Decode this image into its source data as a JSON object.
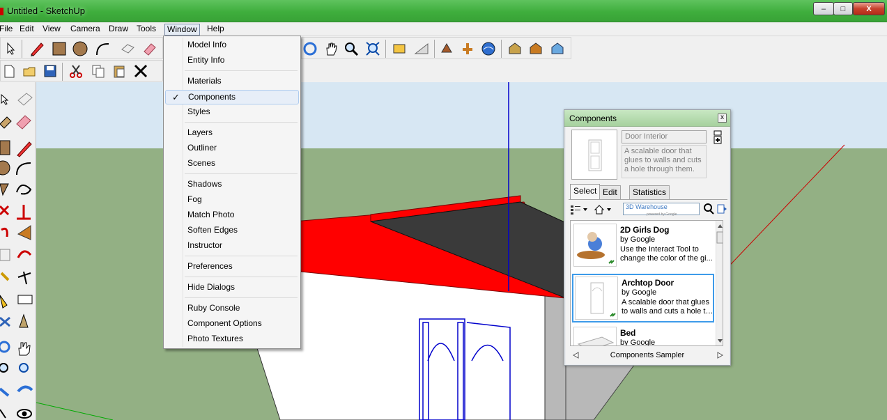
{
  "window": {
    "title": "Untitled - SketchUp",
    "minimize": "–",
    "maximize": "□",
    "close": "X"
  },
  "menubar": {
    "items": [
      "File",
      "Edit",
      "View",
      "Camera",
      "Draw",
      "Tools",
      "Window",
      "Help"
    ]
  },
  "dropdown": {
    "groups": [
      [
        "Model Info",
        "Entity Info"
      ],
      [
        "Materials",
        "Components",
        "Styles"
      ],
      [
        "Layers",
        "Outliner",
        "Scenes"
      ],
      [
        "Shadows",
        "Fog",
        "Match Photo",
        "Soften Edges",
        "Instructor"
      ],
      [
        "Preferences"
      ],
      [
        "Hide Dialogs"
      ],
      [
        "Ruby Console",
        "Component Options",
        "Photo Textures"
      ]
    ],
    "checked_item": "Components",
    "check_glyph": "✓"
  },
  "components": {
    "title": "Components",
    "close_glyph": "x",
    "name": "Door Interior",
    "description": "A scalable door that glues to walls and cuts a hole through them.",
    "tabs": [
      "Select",
      "Edit",
      "Statistics"
    ],
    "active_tab": "Select",
    "search_placeholder": "3D Warehouse",
    "search_brand": "powered by Google",
    "items": [
      {
        "name": "2D Girls Dog",
        "by": "by Google",
        "desc1": "Use the Interact Tool to",
        "desc2": "change the color of the gi..."
      },
      {
        "name": "Archtop Door",
        "by": "by Google",
        "desc1": "A scalable door that glues",
        "desc2": "to walls and cuts a hole th..."
      },
      {
        "name": "Bed",
        "by": "by Google",
        "desc1": "",
        "desc2": ""
      }
    ],
    "selected_item": "Archtop Door",
    "collection": "Components Sampler"
  },
  "colors": {
    "titlebar": "#3fae3d",
    "sky": "#d7e7f3",
    "ground": "#93b084",
    "roof_red": "#ff0000",
    "roof_shingle": "#3a3a3a",
    "wall": "#ffffff",
    "wall_shadow": "#b8b8b8",
    "selection_blue": "#0000cc"
  },
  "icons": {
    "toolbar_row1": [
      "select-icon",
      "pencil-icon",
      "rectangle-icon",
      "circle-icon",
      "arc-icon",
      "make-component-icon",
      "eraser-icon",
      "orbit-icon",
      "pan-icon",
      "zoom-icon",
      "zoom-extents-icon",
      "get-models-icon",
      "share-model-icon",
      "google-earth-icons"
    ],
    "toolbar_row2": [
      "new-icon",
      "open-icon",
      "save-icon",
      "cut-icon",
      "copy-icon",
      "paste-icon",
      "delete-icon"
    ]
  }
}
